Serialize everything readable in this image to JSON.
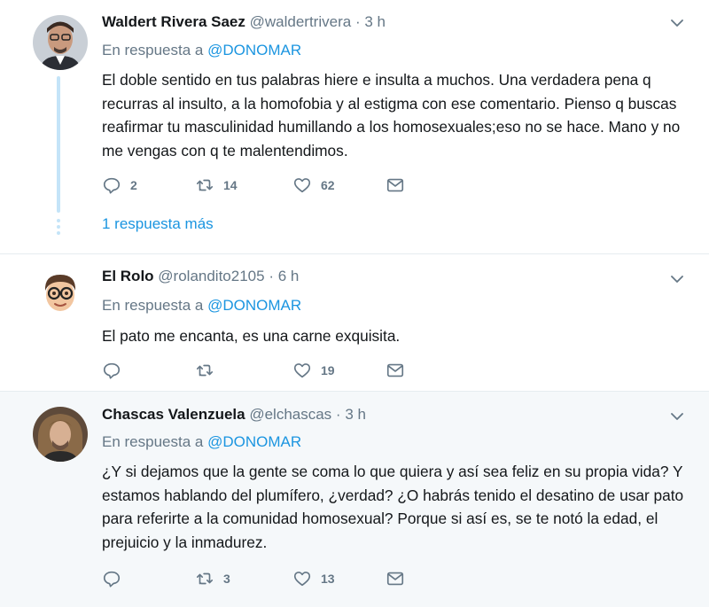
{
  "tweets": [
    {
      "name": "Waldert Rivera Saez",
      "handle": "@waldertrivera",
      "separator": "·",
      "time": "3 h",
      "reply_prefix": "En respuesta a",
      "reply_mention": "@DONOMAR",
      "text": "El doble sentido en tus palabras hiere e insulta a muchos. Una verdadera pena q recurras al insulto, a la homofobia y al estigma con ese comentario. Pienso q buscas reafirmar tu masculinidad humillando a los homosexuales;eso no se hace. Mano y no me vengas con q te malentendimos.",
      "replies": "2",
      "retweets": "14",
      "likes": "62",
      "more_replies": "1 respuesta más"
    },
    {
      "name": "El Rolo",
      "handle": "@rolandito2105",
      "separator": "·",
      "time": "6 h",
      "reply_prefix": "En respuesta a",
      "reply_mention": "@DONOMAR",
      "text": "El pato me encanta, es una carne exquisita.",
      "replies": "",
      "retweets": "",
      "likes": "19"
    },
    {
      "name": "Chascas Valenzuela",
      "handle": "@elchascas",
      "separator": "·",
      "time": "3 h",
      "reply_prefix": "En respuesta a",
      "reply_mention": "@DONOMAR",
      "text": "¿Y si dejamos que la gente se coma lo que quiera y así sea feliz en su propia vida? Y estamos hablando del plumífero, ¿verdad? ¿O habrás tenido el desatino de usar pato para referirte a la comunidad homosexual? Porque si así es, se te notó la edad, el prejuicio y la inmadurez.",
      "replies": "",
      "retweets": "3",
      "likes": "13"
    }
  ],
  "icons": {
    "reply": "reply-icon",
    "retweet": "retweet-icon",
    "like": "heart-icon",
    "message": "envelope-icon",
    "caret": "chevron-down-icon"
  },
  "colors": {
    "link": "#1b95e0",
    "muted": "#657786",
    "text": "#14171a",
    "thread": "#c4e4f8",
    "highlight_bg": "#f5f8fa"
  }
}
